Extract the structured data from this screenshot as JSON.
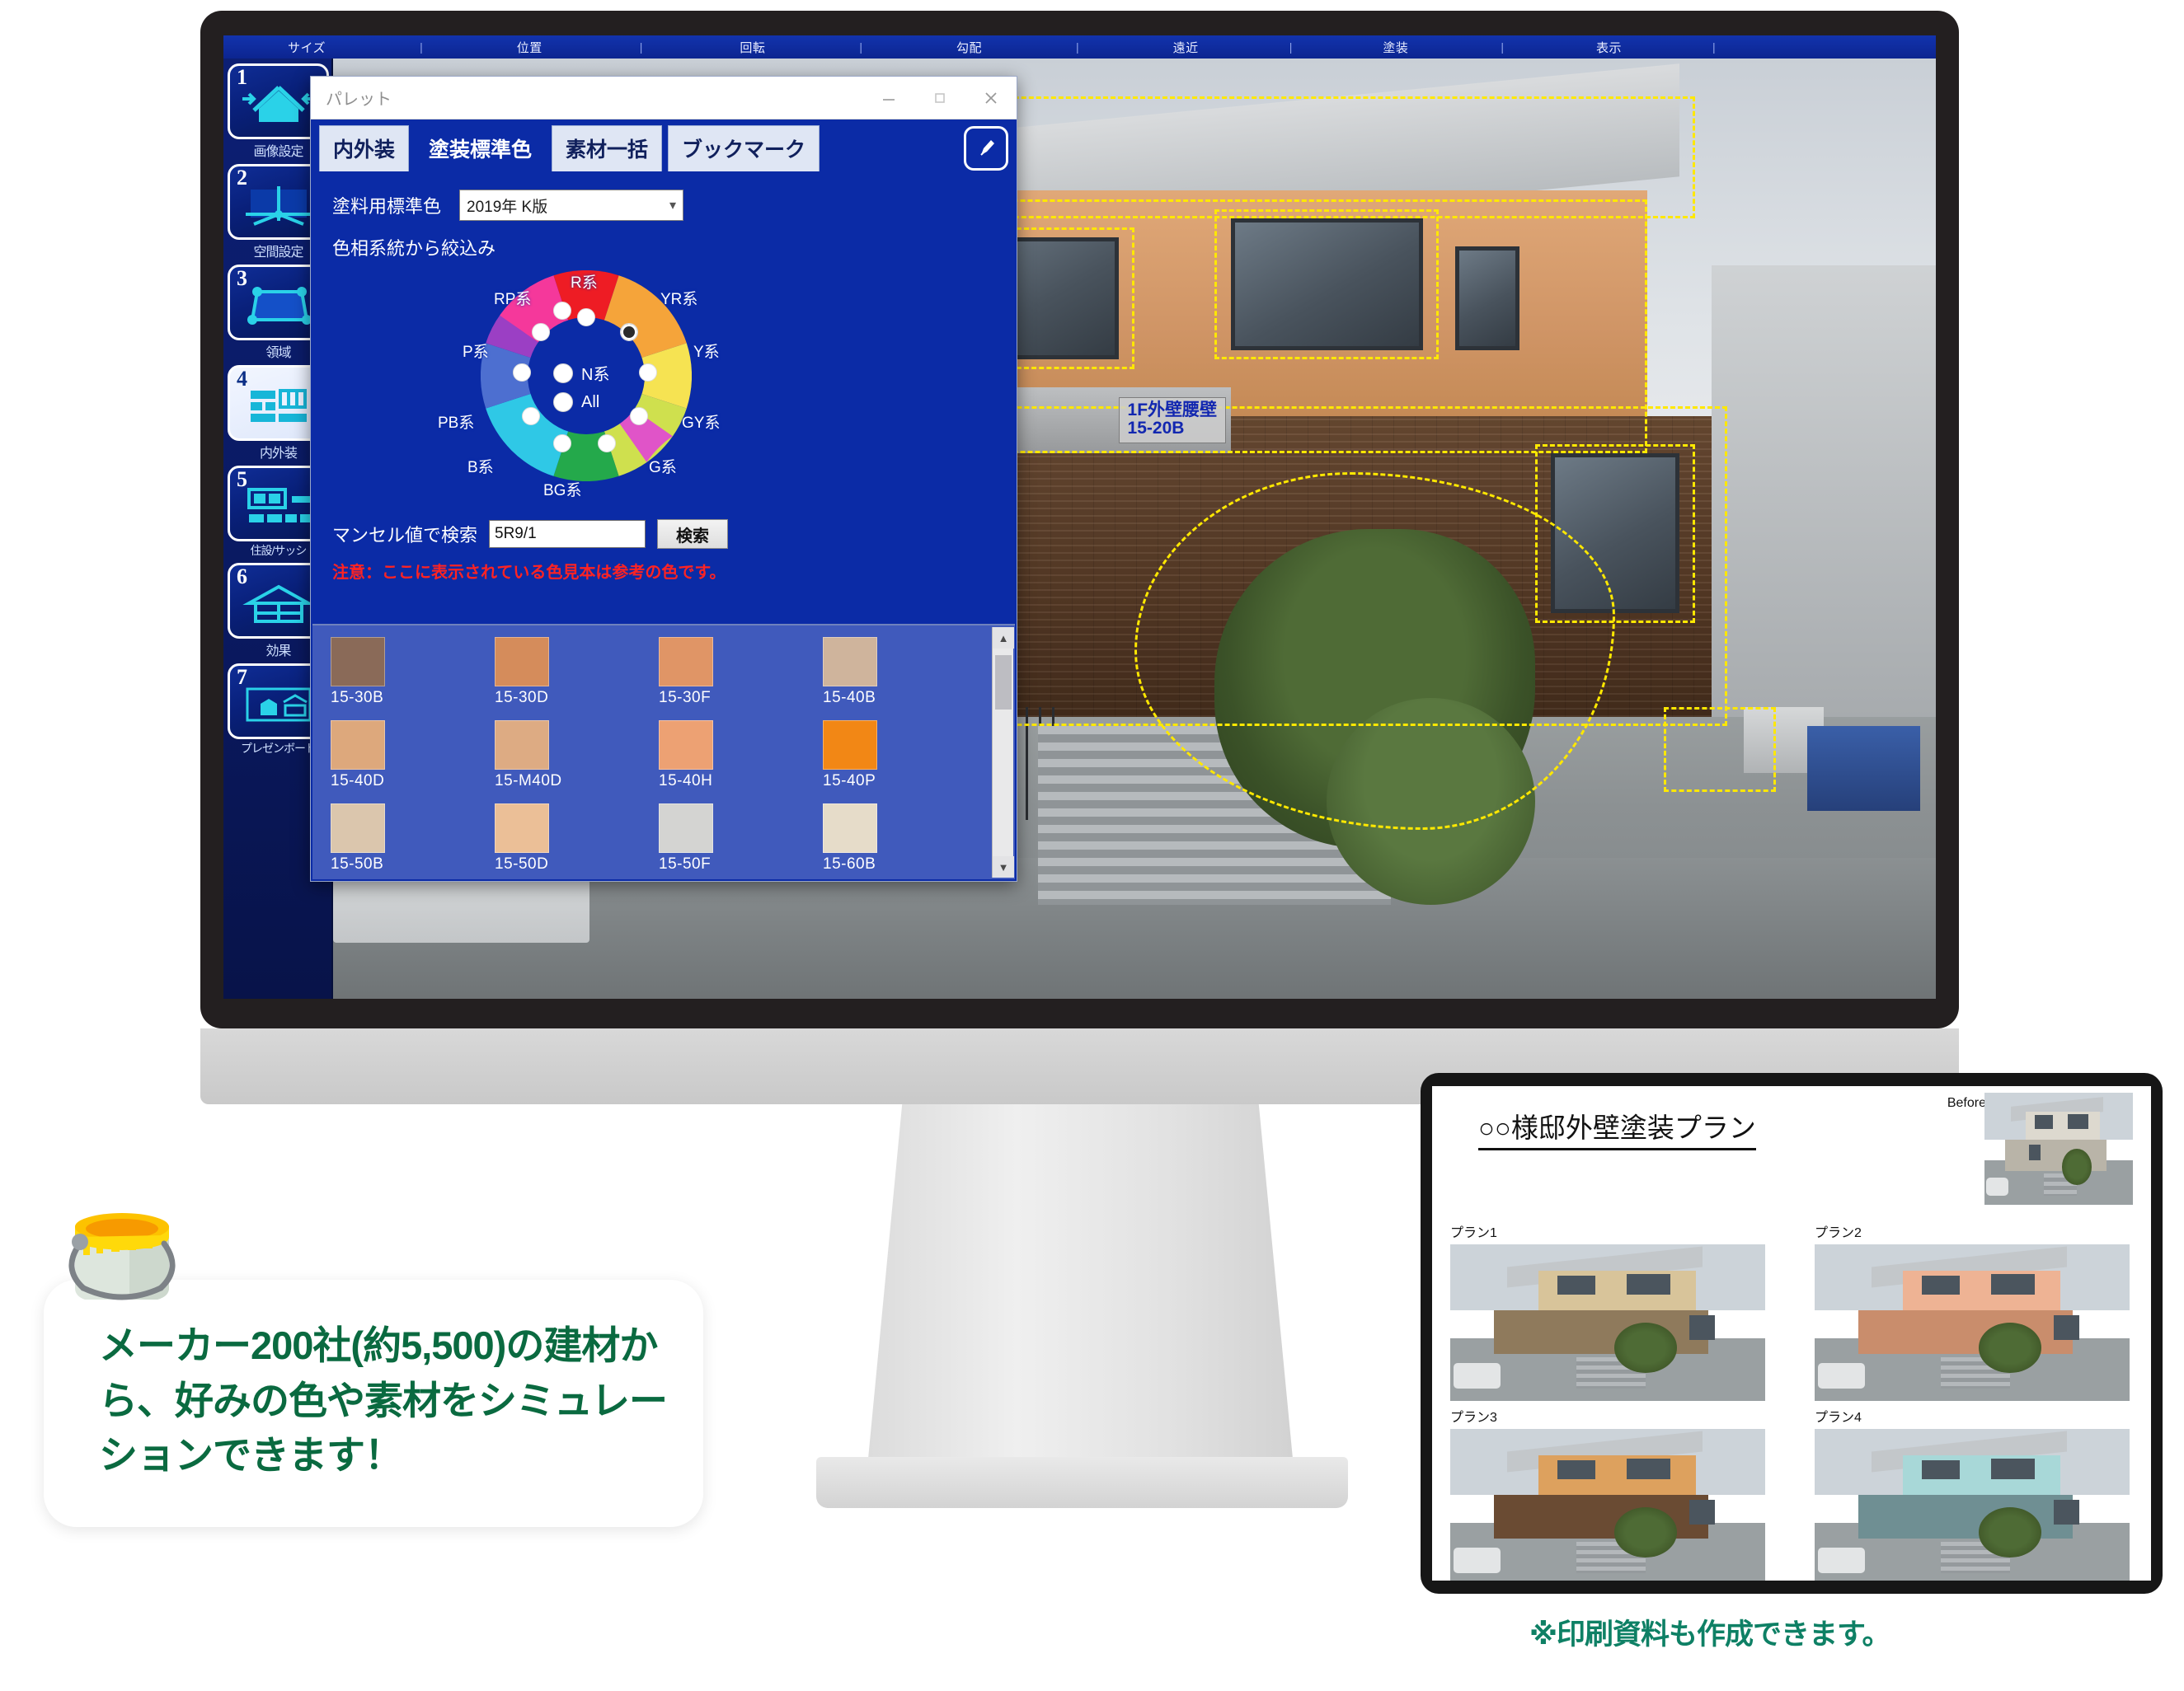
{
  "app": {
    "menubar": [
      "サイズ",
      "位置",
      "回転",
      "勾配",
      "遠近",
      "塗装",
      "表示"
    ],
    "sidebar": [
      {
        "num": "1",
        "label": "画像設定",
        "icon": "house-resize-icon",
        "active": false
      },
      {
        "num": "2",
        "label": "空間設定",
        "icon": "space-grid-icon",
        "active": false
      },
      {
        "num": "3",
        "label": "領域",
        "icon": "region-polygon-icon",
        "active": false
      },
      {
        "num": "4",
        "label": "内外装",
        "icon": "interior-exterior-icon",
        "active": true
      },
      {
        "num": "5",
        "label": "住設/サッシ",
        "icon": "fixtures-sash-icon",
        "active": false
      },
      {
        "num": "6",
        "label": "効果",
        "icon": "effects-house-icon",
        "active": false
      },
      {
        "num": "7",
        "label": "プレゼンボード",
        "icon": "presentation-board-icon",
        "active": false
      }
    ],
    "region_tag": {
      "line1": "1F外壁腰壁",
      "line2": "15-20B"
    }
  },
  "palette": {
    "title": "パレット",
    "window_buttons": {
      "minimize": "minimize-icon",
      "maximize": "maximize-icon",
      "close": "close-icon"
    },
    "tabs": [
      {
        "label": "内外装",
        "active": false
      },
      {
        "label": "塗装標準色",
        "active": true
      },
      {
        "label": "素材一括",
        "active": false
      },
      {
        "label": "ブックマーク",
        "active": false
      }
    ],
    "pen_button": "pen-icon",
    "standard_color_label": "塗料用標準色",
    "standard_color_value": "2019年 K版",
    "hue_filter_label": "色相系統から絞込み",
    "hue_wheel": [
      {
        "code": "R系",
        "color": "#ee1c24",
        "selected": false
      },
      {
        "code": "YR系",
        "color": "#f5a43a",
        "selected": true
      },
      {
        "code": "Y系",
        "color": "#f6e352",
        "selected": false
      },
      {
        "code": "GY系",
        "color": "#cfe04e",
        "selected": false
      },
      {
        "code": "G系",
        "color": "#24a94b",
        "selected": false
      },
      {
        "code": "BG系",
        "color": "#2fc8e6",
        "selected": false
      },
      {
        "code": "B系",
        "color": "#4d6fd0",
        "selected": false
      },
      {
        "code": "PB系",
        "color": "#9b3fc4",
        "selected": false
      },
      {
        "code": "P系",
        "color": "#e054c8",
        "selected": false
      },
      {
        "code": "RP系",
        "color": "#f5389b",
        "selected": false
      }
    ],
    "center_options": [
      {
        "label": "N系",
        "selected": false
      },
      {
        "label": "All",
        "selected": false
      }
    ],
    "munsell_label": "マンセル値で検索",
    "munsell_value": "5R9/1",
    "search_button": "検索",
    "warning": "注意：ここに表示されている色見本は参考の色です。",
    "swatches": [
      {
        "code": "15-30B",
        "color": "#8a6a58"
      },
      {
        "code": "15-30D",
        "color": "#d58c5b"
      },
      {
        "code": "15-30F",
        "color": "#e09566"
      },
      {
        "code": "15-40B",
        "color": "#cfb49c"
      },
      {
        "code": "15-40D",
        "color": "#dda87c"
      },
      {
        "code": "15-M40D",
        "color": "#ddab83"
      },
      {
        "code": "15-40H",
        "color": "#eda173"
      },
      {
        "code": "15-40P",
        "color": "#f28715"
      },
      {
        "code": "15-50B",
        "color": "#dbc6ad"
      },
      {
        "code": "15-50D",
        "color": "#ebbf97"
      },
      {
        "code": "15-50F",
        "color": "#d4d4d2"
      },
      {
        "code": "15-60B",
        "color": "#e6dcc9"
      }
    ],
    "scroll": {
      "up": "scroll-up-arrow",
      "down": "scroll-down-arrow"
    }
  },
  "callout": {
    "text": "メーカー200社(約5,500)の建材から、好みの色や素材をシミュレーションできます！",
    "icon": "paint-bucket-icon",
    "color": "#0a6a40"
  },
  "tablet": {
    "title": "○○様邸外壁塗装プラン",
    "before_label": "Before",
    "plans": [
      {
        "label": "プラン1",
        "wall_upper": "#d8c49a",
        "wall_lower": "#8f7a5c"
      },
      {
        "label": "プラン2",
        "wall_upper": "#eeb394",
        "wall_lower": "#c98d6c"
      },
      {
        "label": "プラン3",
        "wall_upper": "#dda15e",
        "wall_lower": "#6a4b33"
      },
      {
        "label": "プラン4",
        "wall_upper": "#a8d8d8",
        "wall_lower": "#6f8f93"
      }
    ],
    "before_wall_upper": "#ddd9cf",
    "before_wall_lower": "#b9b4a8"
  },
  "print_note": {
    "text": "※印刷資料も作成できます。",
    "color": "#0e8065"
  }
}
